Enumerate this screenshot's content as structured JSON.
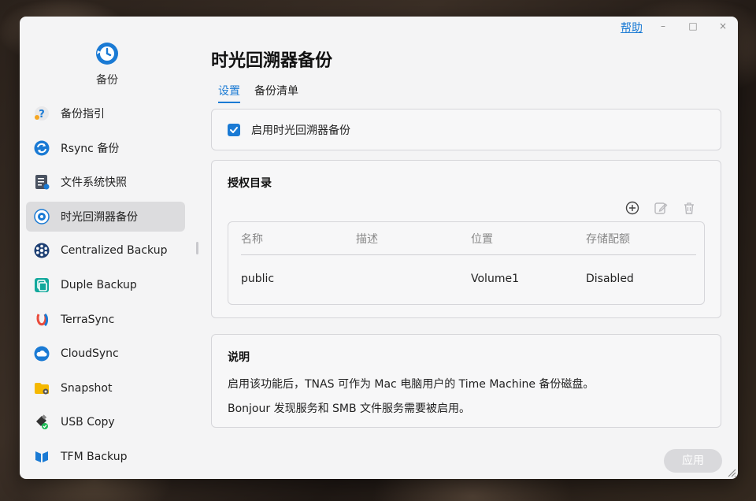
{
  "app": {
    "name": "备份",
    "help_label": "帮助",
    "minimize_glyph": "–",
    "maximize_glyph": "□",
    "close_glyph": "×"
  },
  "sidebar": {
    "items": [
      {
        "label": "备份指引",
        "icon": "help-guide-icon",
        "active": false
      },
      {
        "label": "Rsync 备份",
        "icon": "rsync-icon",
        "active": false
      },
      {
        "label": "文件系统快照",
        "icon": "filesystem-snapshot-icon",
        "active": false
      },
      {
        "label": "时光回溯器备份",
        "icon": "time-machine-icon",
        "active": true
      },
      {
        "label": "Centralized Backup",
        "icon": "centralized-backup-icon",
        "active": false
      },
      {
        "label": "Duple Backup",
        "icon": "duple-backup-icon",
        "active": false
      },
      {
        "label": "TerraSync",
        "icon": "terrasync-icon",
        "active": false
      },
      {
        "label": "CloudSync",
        "icon": "cloudsync-icon",
        "active": false
      },
      {
        "label": "Snapshot",
        "icon": "snapshot-folder-icon",
        "active": false
      },
      {
        "label": "USB Copy",
        "icon": "usb-copy-icon",
        "active": false
      },
      {
        "label": "TFM Backup",
        "icon": "tfm-backup-icon",
        "active": false
      }
    ]
  },
  "main": {
    "title": "时光回溯器备份",
    "tabs": [
      {
        "label": "设置",
        "active": true
      },
      {
        "label": "备份清单",
        "active": false
      }
    ],
    "enable": {
      "label": "启用时光回溯器备份",
      "checked": true
    },
    "authorized": {
      "heading": "授权目录",
      "columns": [
        "名称",
        "描述",
        "位置",
        "存储配额"
      ],
      "rows": [
        {
          "name": "public",
          "description": "",
          "location": "Volume1",
          "quota": "Disabled"
        }
      ]
    },
    "notes": {
      "heading": "说明",
      "lines": [
        "启用该功能后，TNAS 可作为 Mac 电脑用户的 Time Machine 备份磁盘。",
        "Bonjour 发现服务和 SMB 文件服务需要被启用。"
      ]
    },
    "apply_label": "应用"
  },
  "colors": {
    "accent": "#1a7ad4",
    "window_bg": "#f4f4f5",
    "active_item_bg": "#dcdcde"
  }
}
